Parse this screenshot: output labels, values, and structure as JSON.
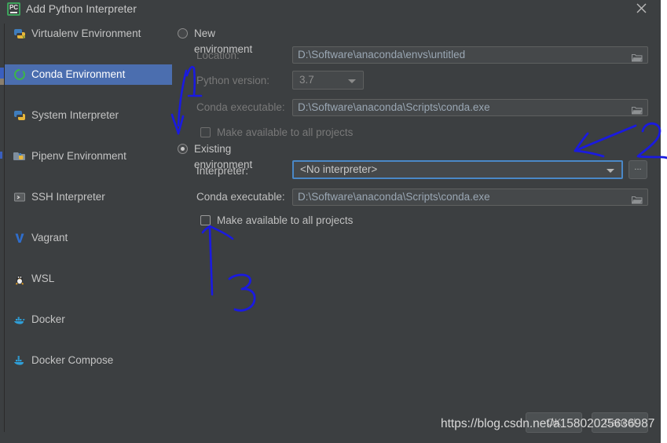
{
  "window": {
    "title": "Add Python Interpreter",
    "app_icon": "pycharm-icon",
    "close_icon": "close-icon"
  },
  "sidebar": {
    "items": [
      {
        "label": "Virtualenv Environment",
        "icon": "virtualenv-icon",
        "selected": false
      },
      {
        "label": "Conda Environment",
        "icon": "conda-icon",
        "selected": true
      },
      {
        "label": "System Interpreter",
        "icon": "python-icon",
        "selected": false
      },
      {
        "label": "Pipenv Environment",
        "icon": "pipenv-icon",
        "selected": false
      },
      {
        "label": "SSH Interpreter",
        "icon": "ssh-terminal-icon",
        "selected": false
      },
      {
        "label": "Vagrant",
        "icon": "vagrant-icon",
        "selected": false
      },
      {
        "label": "WSL",
        "icon": "linux-penguin-icon",
        "selected": false
      },
      {
        "label": "Docker",
        "icon": "docker-icon",
        "selected": false
      },
      {
        "label": "Docker Compose",
        "icon": "docker-compose-icon",
        "selected": false
      }
    ]
  },
  "panel": {
    "new_environment": {
      "radio_label": "New environment",
      "selected": false,
      "location_label": "Location:",
      "location_value": "D:\\Software\\anaconda\\envs\\untitled",
      "python_version_label": "Python version:",
      "python_version_value": "3.7",
      "conda_executable_label": "Conda executable:",
      "conda_executable_value": "D:\\Software\\anaconda\\Scripts\\conda.exe",
      "make_available_label": "Make available to all projects",
      "make_available_checked": false
    },
    "existing_environment": {
      "radio_label": "Existing environment",
      "selected": true,
      "interpreter_label": "Interpreter:",
      "interpreter_value": "<No interpreter>",
      "browse_button_label": "...",
      "conda_executable_label": "Conda executable:",
      "conda_executable_value": "D:\\Software\\anaconda\\Scripts\\conda.exe",
      "make_available_label": "Make available to all projects",
      "make_available_checked": false
    }
  },
  "footer": {
    "ok_label": "OK",
    "cancel_label": "Cancel"
  },
  "watermark": {
    "text": "https://blog.csdn.net/a15802025636987"
  },
  "annotations": {
    "color": "#1a1ae0",
    "marks": [
      {
        "number": "1",
        "points_at": "python-version-field"
      },
      {
        "number": "2",
        "points_at": "interpreter-dropdown"
      },
      {
        "number": "3",
        "points_at": "existing-make-available-checkbox"
      }
    ]
  }
}
